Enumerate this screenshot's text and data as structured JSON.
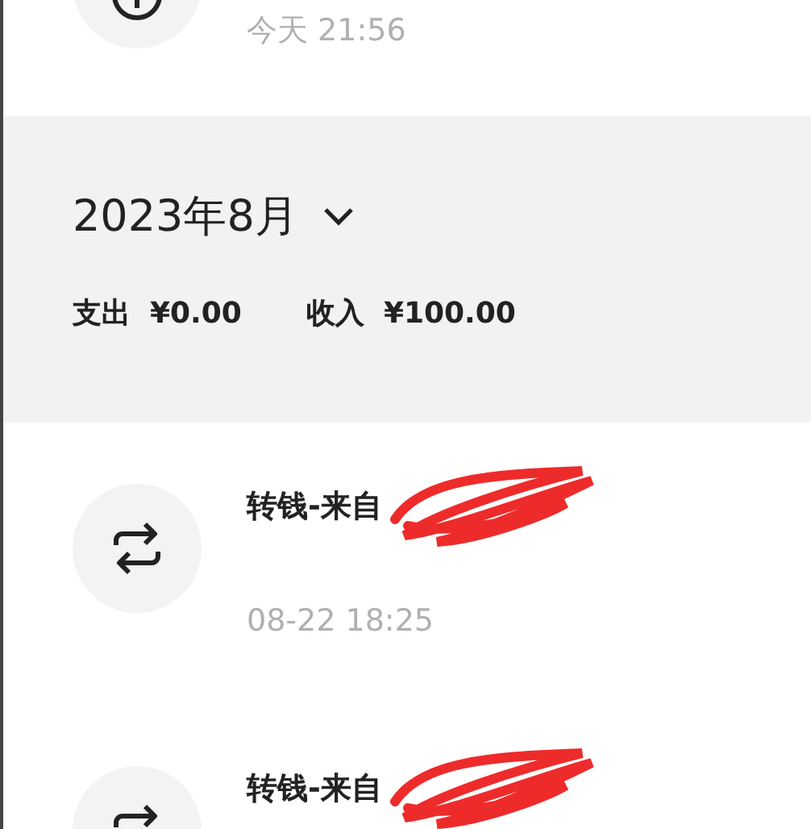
{
  "previous_record": {
    "time": "今天 21:56"
  },
  "month_header": {
    "month": "2023年8月",
    "expense_label": "支出",
    "expense": "¥0.00",
    "income_label": "收入",
    "income": "¥100.00"
  },
  "records": [
    {
      "title": "转钱-来自",
      "redacted": true,
      "time": "08-22 18:25"
    },
    {
      "title": "转钱-来自",
      "redacted": true
    }
  ]
}
